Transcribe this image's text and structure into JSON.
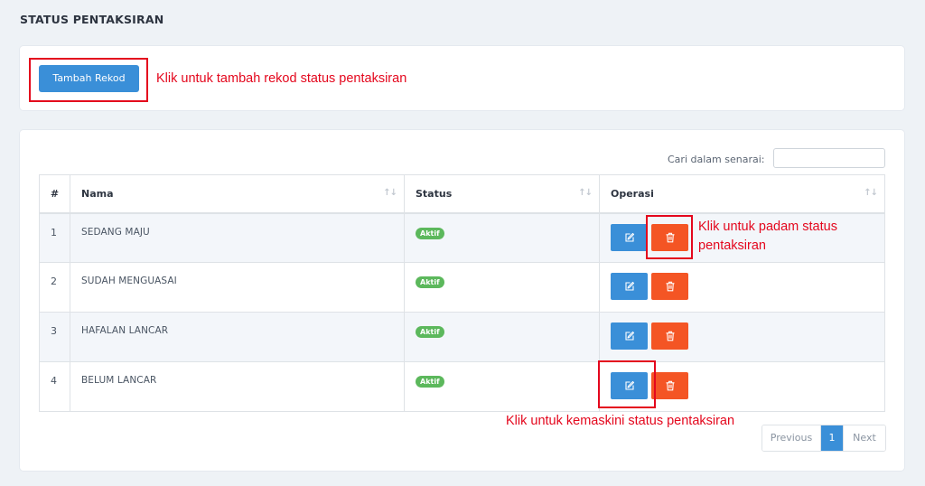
{
  "page": {
    "title": "STATUS PENTAKSIRAN"
  },
  "toolbar": {
    "add_label": "Tambah Rekod"
  },
  "annotations": {
    "add": "Klik untuk tambah rekod status pentaksiran",
    "delete_line1": "Klik untuk padam status",
    "delete_line2": "pentaksiran",
    "edit": "Klik untuk kemaskini status pentaksiran",
    "color": "#e4071d"
  },
  "search": {
    "label": "Cari dalam senarai:",
    "value": "",
    "placeholder": ""
  },
  "table": {
    "headers": {
      "num": "#",
      "name": "Nama",
      "status": "Status",
      "ops": "Operasi"
    },
    "sort_icon": "sort-arrows-icon",
    "rows": [
      {
        "num": "1",
        "name": "SEDANG MAJU",
        "status": "Aktif"
      },
      {
        "num": "2",
        "name": "SUDAH MENGUASAI",
        "status": "Aktif"
      },
      {
        "num": "3",
        "name": "HAFALAN LANCAR",
        "status": "Aktif"
      },
      {
        "num": "4",
        "name": "BELUM LANCAR",
        "status": "Aktif"
      }
    ],
    "edit_icon": "edit-icon",
    "delete_icon": "trash-icon"
  },
  "pagination": {
    "previous": "Previous",
    "current": "1",
    "next": "Next"
  },
  "colors": {
    "primary": "#3a8fd8",
    "danger": "#f45524",
    "success": "#5cb85c",
    "background": "#eef2f6"
  }
}
